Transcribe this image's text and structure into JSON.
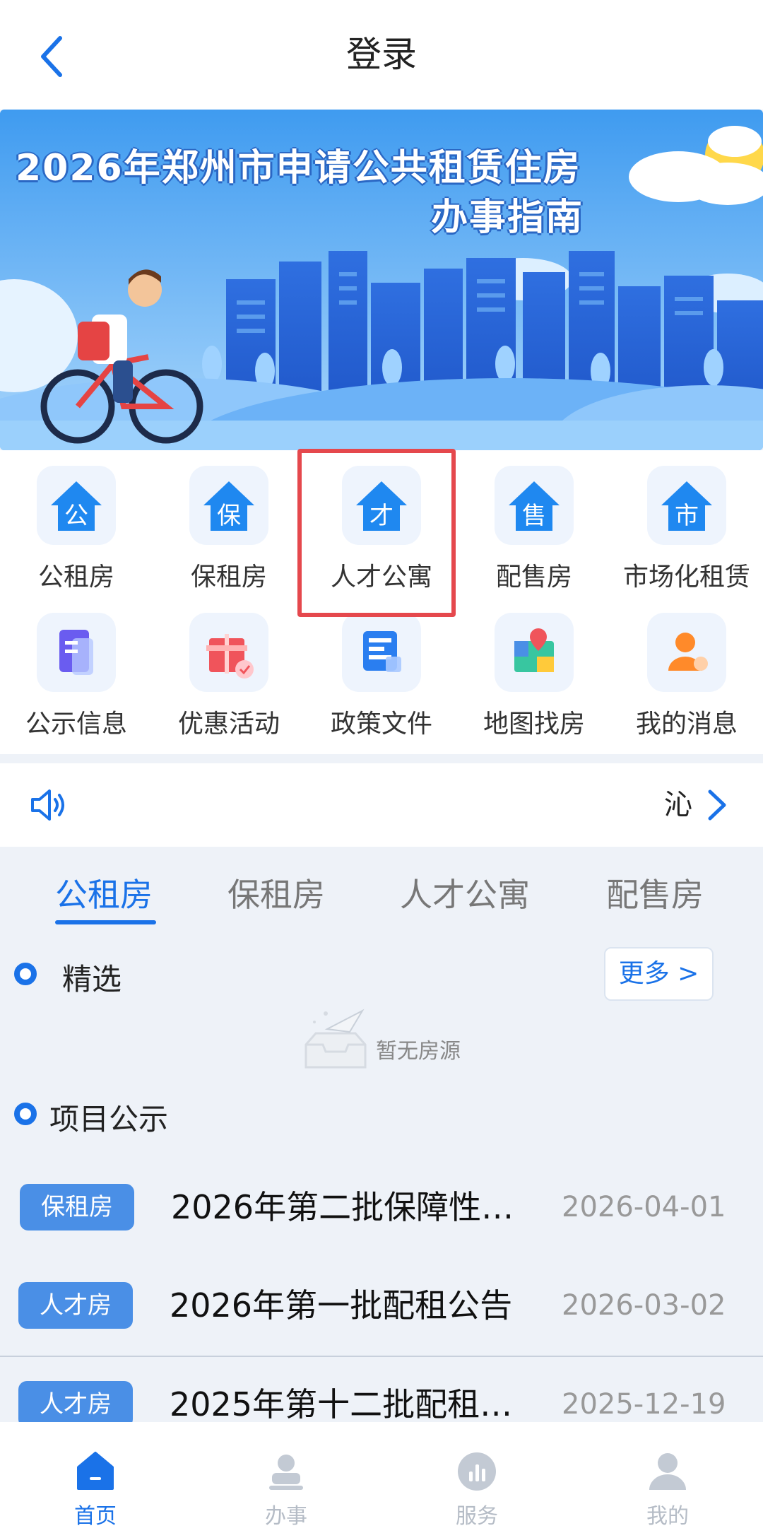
{
  "header": {
    "title": "登录"
  },
  "banner": {
    "line1": "2026年郑州市申请公共租赁住房",
    "line2": "办事指南"
  },
  "grid": [
    {
      "label": "公租房",
      "glyph": "公",
      "icon": "house-gong-icon"
    },
    {
      "label": "保租房",
      "glyph": "保",
      "icon": "house-bao-icon"
    },
    {
      "label": "人才公寓",
      "glyph": "才",
      "icon": "house-cai-icon"
    },
    {
      "label": "配售房",
      "glyph": "售",
      "icon": "house-shou-icon"
    },
    {
      "label": "市场化租赁",
      "glyph": "市",
      "icon": "house-shi-icon"
    },
    {
      "label": "公示信息",
      "icon": "document-icon"
    },
    {
      "label": "优惠活动",
      "icon": "gift-icon"
    },
    {
      "label": "政策文件",
      "icon": "policy-icon"
    },
    {
      "label": "地图找房",
      "icon": "map-icon"
    },
    {
      "label": "我的消息",
      "icon": "user-message-icon"
    }
  ],
  "notice": {
    "text": "沁"
  },
  "tabs": [
    "公租房",
    "保租房",
    "人才公寓",
    "配售房"
  ],
  "featured": {
    "title": "精选",
    "more": "更多 >",
    "empty": "暂无房源"
  },
  "projects": {
    "title": "项目公示",
    "items": [
      {
        "badge": "保租房",
        "title": "2026年第二批保障性…",
        "date": "2026-04-01"
      },
      {
        "badge": "人才房",
        "title": "2026年第一批配租公告",
        "date": "2026-03-02"
      },
      {
        "badge": "人才房",
        "title": "2025年第十二批配租…",
        "date": "2025-12-19"
      }
    ]
  },
  "bottom_nav": [
    {
      "label": "首页",
      "icon": "home-icon"
    },
    {
      "label": "办事",
      "icon": "stamp-icon"
    },
    {
      "label": "服务",
      "icon": "service-chart-icon"
    },
    {
      "label": "我的",
      "icon": "profile-icon"
    }
  ],
  "colors": {
    "accent": "#1a72e8",
    "highlight": "#e5484d",
    "badge": "#4a8fe6"
  }
}
